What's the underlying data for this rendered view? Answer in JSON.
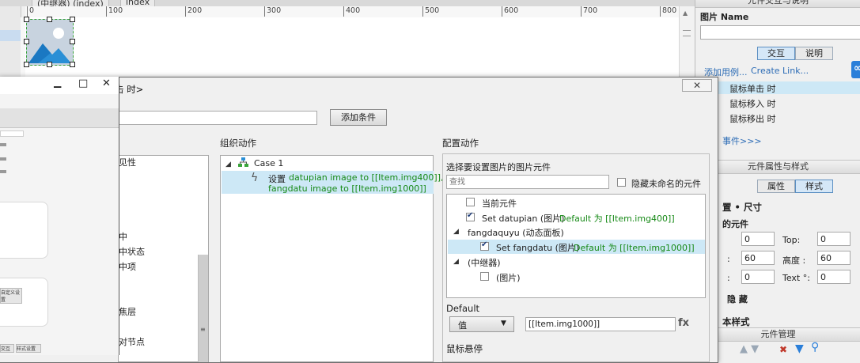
{
  "tabs": {
    "active": "(中继器) (index)",
    "other": "index"
  },
  "ruler": {
    "ticks": [
      "0",
      "100",
      "200",
      "300",
      "400",
      "500",
      "600",
      "700",
      "800"
    ]
  },
  "right_panel": {
    "interaction_head": "元件交互与说明",
    "image_name_label": "图片 Name",
    "image_name_value": "",
    "tab_interaction": "交互",
    "tab_notes": "说明",
    "add_case": "添加用例...",
    "create_link": "Create Link...",
    "events": [
      "鼠标单击 时",
      "鼠标移入 时",
      "鼠标移出 时"
    ],
    "more_events": "事件>>>",
    "props_head": "元件属性与样式",
    "tab_props": "属性",
    "tab_style": "样式",
    "pos_size": "置 • 尺寸",
    "widget_label": "的元件",
    "x_value": "0",
    "top_label": "Top:",
    "top_value": "0",
    "w_value": "60",
    "height_label": "高度 :",
    "height_value": "60",
    "rot_value": "0",
    "text_rot_label": "Text °:",
    "text_rot_value": "0",
    "hide_label": "隐 藏",
    "base_style": "本样式",
    "manage_head": "元件管理"
  },
  "dialog": {
    "title": "击 时>",
    "close": "✕",
    "add_condition": "添加条件",
    "condition_value": "",
    "left_events": [
      "见性",
      "中",
      "中状态",
      "中项",
      "焦层",
      "对节点"
    ],
    "organize_title": "组织动作",
    "case_label": "Case 1",
    "action_prefix": "设置",
    "action_line1": "datupian image to [[Item.img400]],",
    "action_line2": "fangdatu image to [[Item.img1000]]",
    "config_title": "配置动作",
    "select_label": "选择要设置图片的图片元件",
    "search_placeholder": "查找",
    "hide_unnamed": "隐藏未命名的元件",
    "tree": {
      "current": "当前元件",
      "datupian_set": "Set datupian (图片)",
      "datupian_default": "Default 为 [[Item.img400]]",
      "panel": "fangdaquyu (动态面板)",
      "fangdatu_set": "Set fangdatu (图片)",
      "fangdatu_default": "Default 为 [[Item.img1000]]",
      "repeater": "(中继器)",
      "image": "(图片)"
    },
    "default_label": "Default",
    "value_select": "值",
    "value_input": "[[Item.img1000]]",
    "fx": "fx",
    "hover_label": "鼠标悬停"
  },
  "float_window": {
    "minimize": "▁",
    "maximize": "□",
    "close": "✕",
    "mini_labels": [
      "自定义设置",
      "交互",
      "样式设置"
    ]
  },
  "colors": {
    "selection_blue": "#cde8f6",
    "accent_blue": "#2b6bb5",
    "green_text": "#178a17"
  }
}
